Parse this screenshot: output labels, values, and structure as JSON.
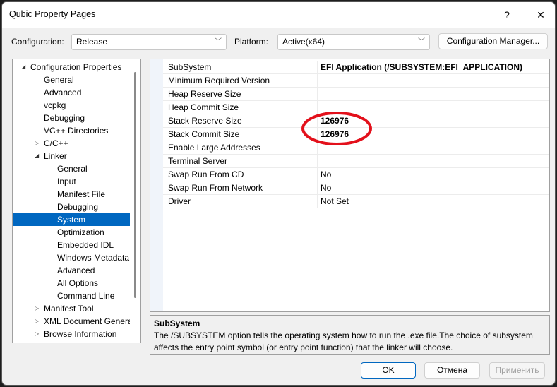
{
  "window": {
    "title": "Qubic Property Pages",
    "help": "?",
    "close": "✕"
  },
  "toolbar": {
    "config_label": "Configuration:",
    "config_value": "Release",
    "platform_label": "Platform:",
    "platform_value": "Active(x64)",
    "config_manager": "Configuration Manager..."
  },
  "tree": [
    {
      "label": "Configuration Properties",
      "level": 0,
      "expander": "expanded"
    },
    {
      "label": "General",
      "level": 1
    },
    {
      "label": "Advanced",
      "level": 1
    },
    {
      "label": "vcpkg",
      "level": 1
    },
    {
      "label": "Debugging",
      "level": 1
    },
    {
      "label": "VC++ Directories",
      "level": 1
    },
    {
      "label": "C/C++",
      "level": 1,
      "expander": "collapsed"
    },
    {
      "label": "Linker",
      "level": 1,
      "expander": "expanded"
    },
    {
      "label": "General",
      "level": 2
    },
    {
      "label": "Input",
      "level": 2
    },
    {
      "label": "Manifest File",
      "level": 2
    },
    {
      "label": "Debugging",
      "level": 2
    },
    {
      "label": "System",
      "level": 2,
      "selected": true
    },
    {
      "label": "Optimization",
      "level": 2
    },
    {
      "label": "Embedded IDL",
      "level": 2
    },
    {
      "label": "Windows Metadata",
      "level": 2
    },
    {
      "label": "Advanced",
      "level": 2
    },
    {
      "label": "All Options",
      "level": 2
    },
    {
      "label": "Command Line",
      "level": 2
    },
    {
      "label": "Manifest Tool",
      "level": 1,
      "expander": "collapsed"
    },
    {
      "label": "XML Document Generator",
      "level": 1,
      "expander": "collapsed"
    },
    {
      "label": "Browse Information",
      "level": 1,
      "expander": "collapsed"
    }
  ],
  "properties": [
    {
      "name": "SubSystem",
      "value": "EFI Application (/SUBSYSTEM:EFI_APPLICATION)",
      "bold": true
    },
    {
      "name": "Minimum Required Version",
      "value": ""
    },
    {
      "name": "Heap Reserve Size",
      "value": ""
    },
    {
      "name": "Heap Commit Size",
      "value": ""
    },
    {
      "name": "Stack Reserve Size",
      "value": "126976",
      "bold": true
    },
    {
      "name": "Stack Commit Size",
      "value": "126976",
      "bold": true
    },
    {
      "name": "Enable Large Addresses",
      "value": ""
    },
    {
      "name": "Terminal Server",
      "value": ""
    },
    {
      "name": "Swap Run From CD",
      "value": "No"
    },
    {
      "name": "Swap Run From Network",
      "value": "No"
    },
    {
      "name": "Driver",
      "value": "Not Set"
    }
  ],
  "annotation_color": "#e3101b",
  "selection_color": "#0067c0",
  "description": {
    "title": "SubSystem",
    "text": "The /SUBSYSTEM option tells the operating system how to run the .exe file.The choice of subsystem affects the entry point symbol (or entry point function) that the linker will choose."
  },
  "buttons": {
    "ok": "OK",
    "cancel": "Отмена",
    "apply": "Применить"
  }
}
